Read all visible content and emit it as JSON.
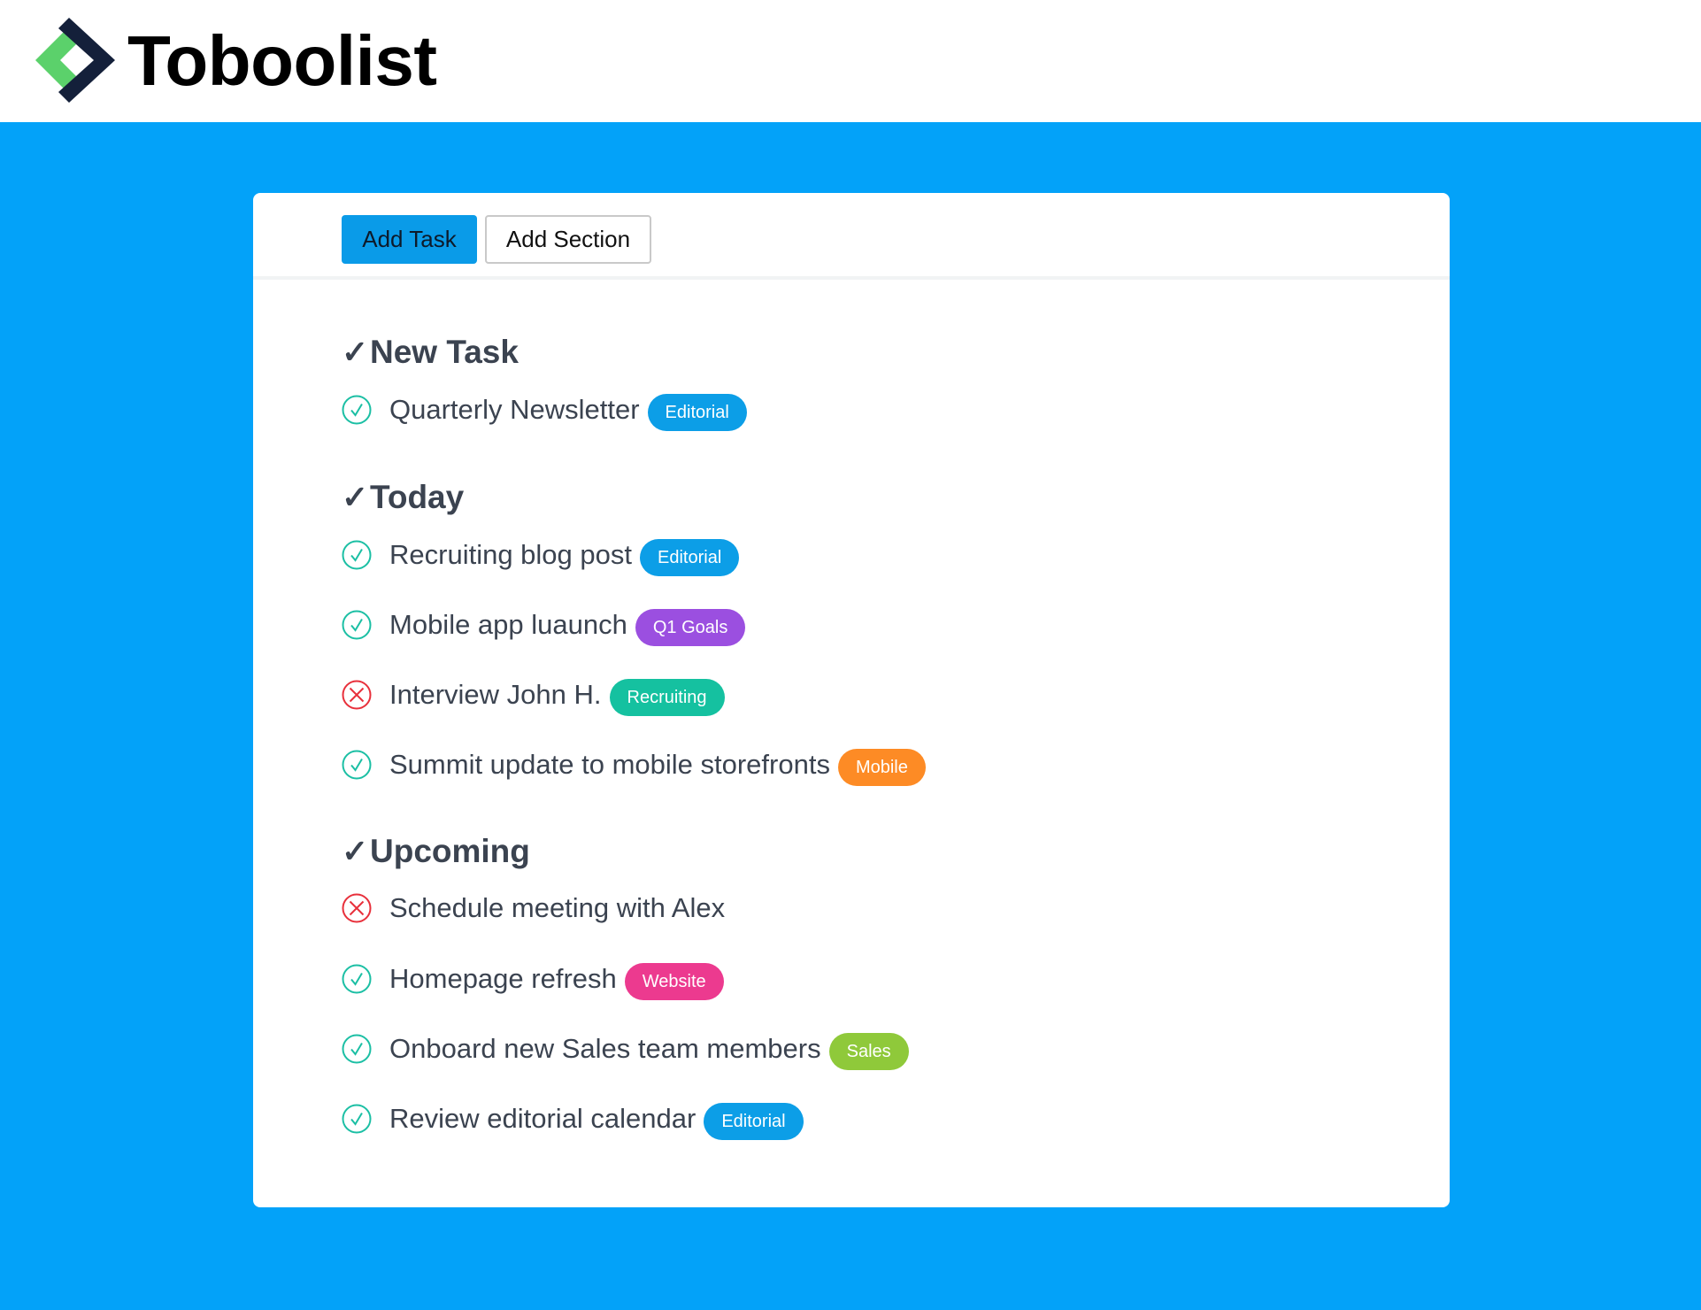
{
  "app": {
    "name": "Toboolist",
    "logo_icon": "diamond-chevron-logo"
  },
  "colors": {
    "background": "#03a2f9",
    "primary_button": "#0a9be8",
    "done_icon": "#1bbfa4",
    "cancelled_icon": "#e8303b"
  },
  "toolbar": {
    "add_task_label": "Add Task",
    "add_section_label": "Add Section"
  },
  "sections": [
    {
      "title": "New Task",
      "tasks": [
        {
          "label": "Quarterly Newsletter",
          "status": "done",
          "tag": "Editorial",
          "tag_color": "#0c9ee7"
        }
      ]
    },
    {
      "title": "Today",
      "tasks": [
        {
          "label": "Recruiting blog post",
          "status": "done",
          "tag": "Editorial",
          "tag_color": "#0c9ee7"
        },
        {
          "label": "Mobile app luaunch",
          "status": "done",
          "tag": "Q1 Goals",
          "tag_color": "#9b4fe0"
        },
        {
          "label": "Interview John H.",
          "status": "cancelled",
          "tag": "Recruiting",
          "tag_color": "#15c1a0"
        },
        {
          "label": "Summit update to mobile storefronts",
          "status": "done",
          "tag": "Mobile",
          "tag_color": "#fd8b25"
        }
      ]
    },
    {
      "title": "Upcoming",
      "tasks": [
        {
          "label": "Schedule meeting with Alex",
          "status": "cancelled",
          "tag": "",
          "tag_color": ""
        },
        {
          "label": "Homepage refresh",
          "status": "done",
          "tag": "Website",
          "tag_color": "#ec3a8f"
        },
        {
          "label": "Onboard new Sales team members",
          "status": "done",
          "tag": "Sales",
          "tag_color": "#8fc93a"
        },
        {
          "label": "Review editorial calendar",
          "status": "done",
          "tag": "Editorial",
          "tag_color": "#0c9ee7"
        }
      ]
    }
  ]
}
